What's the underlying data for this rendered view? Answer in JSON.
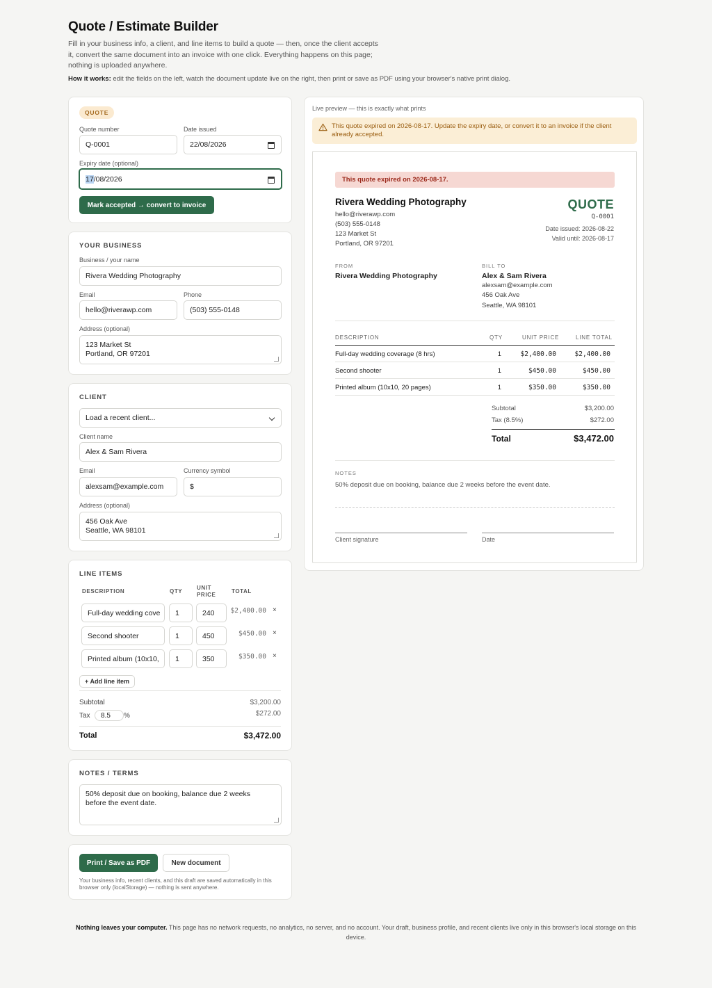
{
  "header": {
    "title": "Quote / Estimate Builder",
    "intro": "Fill in your business info, a client, and line items to build a quote — then, once the client accepts it, convert the same document into an invoice with one click. Everything happens on this page; nothing is uploaded anywhere.",
    "how_label": "How it works:",
    "how_text": "edit the fields on the left, watch the document update live on the right, then print or save as PDF using your browser's native print dialog."
  },
  "doc_meta": {
    "badge": "QUOTE",
    "quote_number_label": "Quote number",
    "quote_number": "Q-0001",
    "date_issued_label": "Date issued",
    "date_issued": "22/08/2026",
    "expiry_label": "Expiry date (optional)",
    "expiry_day": "17",
    "expiry_rest": "/08/2026",
    "convert_button": "Mark accepted → convert to invoice"
  },
  "business": {
    "section_title": "YOUR BUSINESS",
    "name_label": "Business / your name",
    "name": "Rivera Wedding Photography",
    "email_label": "Email",
    "email": "hello@riverawp.com",
    "phone_label": "Phone",
    "phone": "(503) 555-0148",
    "address_label": "Address (optional)",
    "address": "123 Market St\nPortland, OR 97201"
  },
  "client": {
    "section_title": "CLIENT",
    "load_recent": "Load a recent client...",
    "name_label": "Client name",
    "name": "Alex & Sam Rivera",
    "email_label": "Email",
    "email": "alexsam@example.com",
    "currency_label": "Currency symbol",
    "currency": "$",
    "address_label": "Address (optional)",
    "address": "456 Oak Ave\nSeattle, WA 98101"
  },
  "line_items": {
    "section_title": "LINE ITEMS",
    "col_description": "DESCRIPTION",
    "col_qty": "QTY",
    "col_unit_price": "UNIT PRICE",
    "col_total": "TOTAL",
    "rows": [
      {
        "description": "Full-day wedding cove",
        "qty": "1",
        "unit_price": "240",
        "total": "$2,400.00"
      },
      {
        "description": "Second shooter",
        "qty": "1",
        "unit_price": "450",
        "total": "$450.00"
      },
      {
        "description": "Printed album (10x10,",
        "qty": "1",
        "unit_price": "350",
        "total": "$350.00"
      }
    ],
    "remove_glyph": "×",
    "add_button": "+ Add line item",
    "subtotal_label": "Subtotal",
    "subtotal": "$3,200.00",
    "tax_label": "Tax",
    "tax_rate": "8.5",
    "tax_pct": "%",
    "tax_amount": "$272.00",
    "total_label": "Total",
    "total": "$3,472.00"
  },
  "notes": {
    "section_title": "NOTES / TERMS",
    "text": "50% deposit due on booking, balance due 2 weeks\nbefore the event date."
  },
  "actions": {
    "print_button": "Print / Save as PDF",
    "new_button": "New document",
    "storage_note": "Your business info, recent clients, and this draft are saved automatically in this browser only (localStorage) — nothing is sent anywhere."
  },
  "preview": {
    "label": "Live preview — this is exactly what prints",
    "warning": "This quote expired on 2026-08-17. Update the expiry date, or convert it to an invoice if the client already accepted.",
    "expired_banner": "This quote expired on 2026-08-17.",
    "biz_name": "Rivera Wedding Photography",
    "biz_email": "hello@riverawp.com",
    "biz_phone": "(503) 555-0148",
    "biz_addr1": "123 Market St",
    "biz_addr2": "Portland, OR 97201",
    "doc_type": "QUOTE",
    "doc_number": "Q-0001",
    "date_issued": "Date issued: 2026-08-22",
    "valid_until": "Valid until: 2026-08-17",
    "from_label": "FROM",
    "from_name": "Rivera Wedding Photography",
    "bill_to_label": "BILL TO",
    "client_name": "Alex & Sam Rivera",
    "client_email": "alexsam@example.com",
    "client_addr1": "456 Oak Ave",
    "client_addr2": "Seattle, WA 98101",
    "th_description": "DESCRIPTION",
    "th_qty": "QTY",
    "th_unit": "UNIT PRICE",
    "th_total": "LINE TOTAL",
    "rows": [
      {
        "description": "Full-day wedding coverage (8 hrs)",
        "qty": "1",
        "unit": "$2,400.00",
        "total": "$2,400.00"
      },
      {
        "description": "Second shooter",
        "qty": "1",
        "unit": "$450.00",
        "total": "$450.00"
      },
      {
        "description": "Printed album (10x10, 20 pages)",
        "qty": "1",
        "unit": "$350.00",
        "total": "$350.00"
      }
    ],
    "subtotal_label": "Subtotal",
    "subtotal": "$3,200.00",
    "tax_label": "Tax (8.5%)",
    "tax": "$272.00",
    "total_label": "Total",
    "total": "$3,472.00",
    "notes_label": "NOTES",
    "notes": "50% deposit due on booking, balance due 2 weeks before the event date.",
    "sig_label": "Client signature",
    "date_label": "Date"
  },
  "footer": {
    "bold": "Nothing leaves your computer.",
    "text": "This page has no network requests, no analytics, no server, and no account. Your draft, business profile, and recent clients live only in this browser's local storage on this device."
  },
  "colors": {
    "accent": "#2e6b4a",
    "warning_bg": "#fbeed6",
    "expired_bg": "#f6d8d3",
    "badge_bg": "#fbead0"
  }
}
